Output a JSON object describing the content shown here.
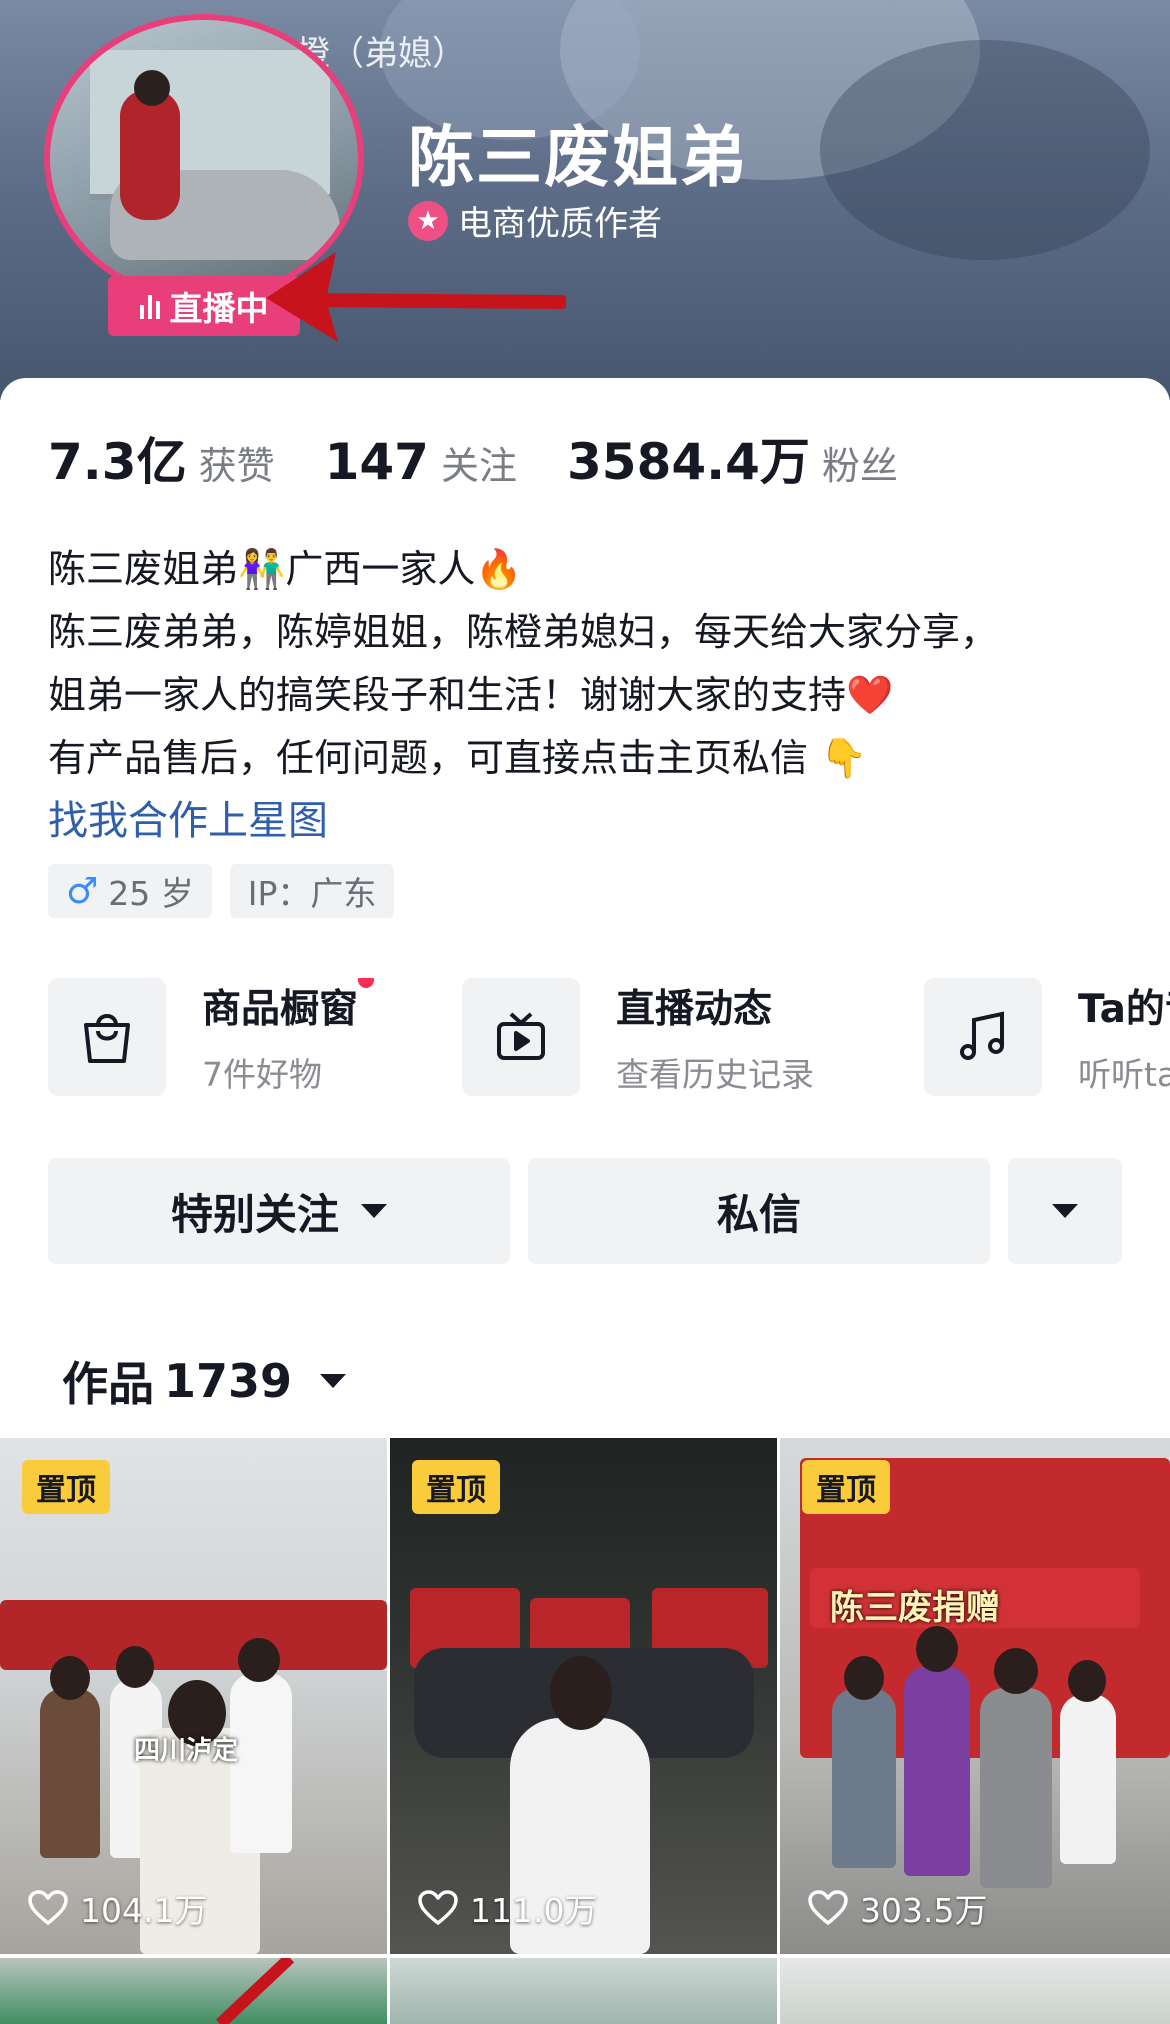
{
  "header": {
    "top_tag": "陈橙（弟媳）",
    "live_label": "直播中",
    "name": "陈三废姐弟",
    "certification": "电商优质作者"
  },
  "stats": [
    {
      "value": "7.3亿",
      "label": "获赞"
    },
    {
      "value": "147",
      "label": "关注"
    },
    {
      "value": "3584.4万",
      "label": "粉丝"
    }
  ],
  "bio": {
    "lines": [
      "陈三废姐弟👫广西一家人🔥",
      "陈三废弟弟，陈婷姐姐，陈橙弟媳妇，每天给大家分享，",
      "姐弟一家人的搞笑段子和生活！谢谢大家的支持❤️",
      "有产品售后，任何问题，可直接点击主页私信 👇"
    ],
    "link": "找我合作上星图"
  },
  "tags": {
    "gender_symbol": "♂",
    "age": "25 岁",
    "ip": "IP：广东"
  },
  "features": [
    {
      "icon": "shopping-bag-icon",
      "title": "商品橱窗",
      "subtitle": "7件好物"
    },
    {
      "icon": "tv-play-icon",
      "title": "直播动态",
      "subtitle": "查看历史记录"
    },
    {
      "icon": "music-note-icon",
      "title": "Ta的音乐",
      "subtitle": "听听ta喜欢的"
    }
  ],
  "actions": {
    "special_follow": "特别关注",
    "message": "私信"
  },
  "works": {
    "label": "作品",
    "count": "1739"
  },
  "videos": [
    {
      "pinned": "置顶",
      "likes": "104.1万",
      "caption": "四川泸定"
    },
    {
      "pinned": "置顶",
      "likes": "111.0万",
      "caption": ""
    },
    {
      "pinned": "置顶",
      "likes": "303.5万",
      "caption": "陈三废捐赠"
    }
  ],
  "colors": {
    "accent_pink": "#e83f7b",
    "link_blue": "#2f5eab",
    "pin_yellow": "#facc3b",
    "red_dot": "#fe2c55"
  }
}
